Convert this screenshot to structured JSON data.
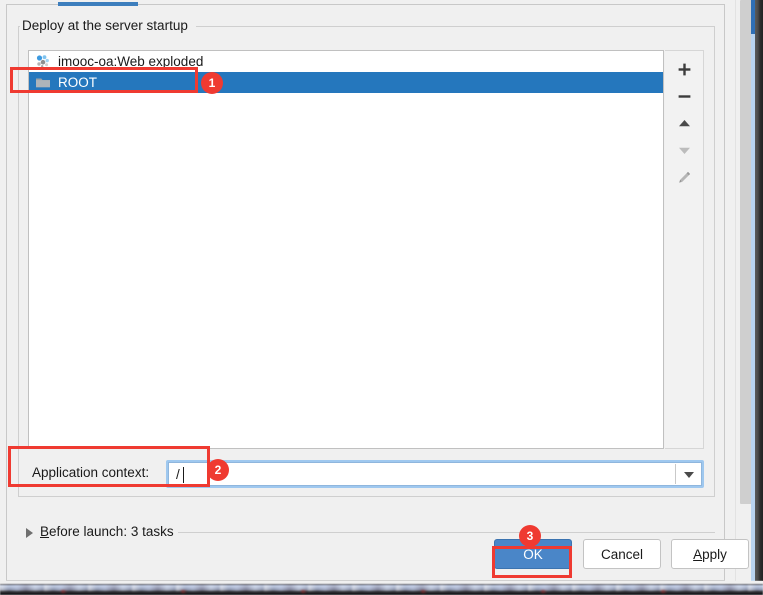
{
  "dialog": {
    "group_title": "Deploy at the server startup",
    "tab_indicator": "active-tab-underline"
  },
  "deployment_list": {
    "items": [
      {
        "label": "imooc-oa:Web exploded",
        "icon": "artifact-icon",
        "selected": false
      },
      {
        "label": "ROOT",
        "icon": "folder-icon",
        "selected": true
      }
    ]
  },
  "list_toolbar": {
    "buttons": [
      {
        "name": "add-button",
        "icon": "plus-icon"
      },
      {
        "name": "remove-button",
        "icon": "minus-icon"
      },
      {
        "name": "move-up-button",
        "icon": "arrow-up-icon"
      },
      {
        "name": "move-down-button",
        "icon": "arrow-down-icon"
      },
      {
        "name": "edit-button",
        "icon": "pencil-icon"
      }
    ]
  },
  "application_context": {
    "label": "Application context:",
    "value": "/",
    "placeholder": "",
    "dropdown_icon": "chevron-down-icon"
  },
  "before_launch": {
    "prefix": "B",
    "text": "efore launch: 3 tasks",
    "full_text": "Before launch: 3 tasks",
    "expander_icon": "triangle-right-icon",
    "collapsed": true
  },
  "footer": {
    "ok_label": "OK",
    "cancel_label": "Cancel",
    "apply_prefix": "A",
    "apply_rest": "pply",
    "apply_label": "Apply"
  },
  "annotations": {
    "badges": [
      {
        "number": "1",
        "target": "deployment-list-root-row"
      },
      {
        "number": "2",
        "target": "application-context-field"
      },
      {
        "number": "3",
        "target": "ok-button"
      }
    ],
    "highlight_color": "#ef3a31"
  },
  "colors": {
    "selection_blue": "#2577bd",
    "accent_blue": "#3d7ebd",
    "ok_button_blue": "#4a86c8",
    "annotation_red": "#ef3a31",
    "dialog_background": "#f0f0f0",
    "list_background": "#ffffff"
  }
}
